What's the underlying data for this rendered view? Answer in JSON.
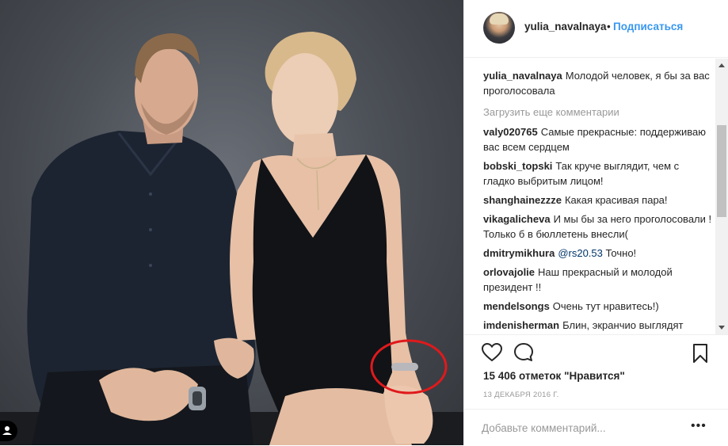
{
  "post": {
    "username": "yulia_navalnaya",
    "separator": "•",
    "follow_label": "Подписаться",
    "caption": {
      "user": "yulia_navalnaya",
      "text": "Молодой человек, я бы за вас проголосовала"
    },
    "load_more_label": "Загрузить еще комментарии",
    "comments": [
      {
        "user": "valy020765",
        "text": "Самые прекрасные: поддерживаю вас всем сердцем"
      },
      {
        "user": "bobski_topski",
        "text": "Так круче выглядит, чем с гладко выбритым лицом!"
      },
      {
        "user": "shanghainezzze",
        "text": "Какая красивая пара!"
      },
      {
        "user": "vikagalicheva",
        "text": "И мы бы за него проголосовали ! Только б в бюллетень внесли("
      },
      {
        "user": "dmitrymikhura",
        "mention": "@rs20.53",
        "text": "Точно!"
      },
      {
        "user": "orlovajolie",
        "text": "Наш прекрасный и молодой президент !!"
      },
      {
        "user": "mendelsongs",
        "text": "Очень тут нравитесь!)"
      },
      {
        "user": "imdenisherman",
        "text": "Блин, экранчио выглядят"
      }
    ],
    "likes_text": "15 406 отметок \"Нравится\"",
    "date": "13 ДЕКАБРЯ 2016 Г.",
    "comment_placeholder": "Добавьте комментарий...",
    "more_label": "•••"
  },
  "icons": {
    "like": "heart-icon",
    "comment": "comment-bubble-icon",
    "save": "bookmark-icon",
    "tag": "user-tag-icon"
  },
  "colors": {
    "link_blue": "#3897f0",
    "muted": "#999999",
    "annotation_circle": "#e0191c"
  }
}
